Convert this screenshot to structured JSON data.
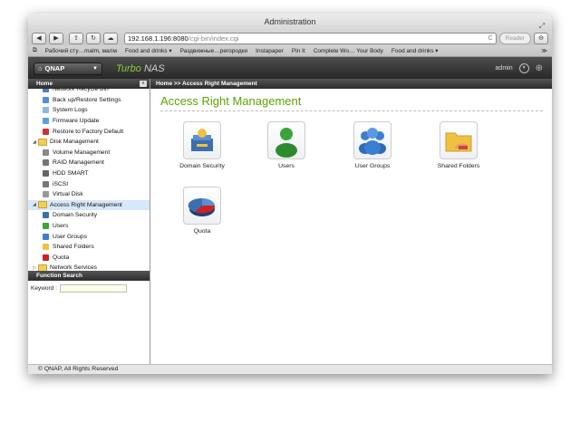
{
  "browser": {
    "window_title": "Administration",
    "url_host": "192.168.1.196:8080",
    "url_path": "/cgi-bin/index.cgi",
    "reader_label": "Reader",
    "bookmarks": [
      "Рабочий сту…malm, малм",
      "Food and drinks ▾",
      "Раздвижные…регородки",
      "Instapaper",
      "Pin It",
      "Complete Wo… Your Body",
      "Food and drinks ▾",
      "≫"
    ]
  },
  "app": {
    "logo_label": "QNAP",
    "product_turbo": "Turbo",
    "product_nas": "NAS",
    "user": "admin"
  },
  "sidebar": {
    "header": "Home",
    "tree": [
      {
        "label": "Network Recycle Bin",
        "level": 2,
        "color": "#4a7fc0"
      },
      {
        "label": "Back up/Restore Settings",
        "level": 2,
        "color": "#4e8fd6"
      },
      {
        "label": "System Logs",
        "level": 2,
        "color": "#8fb6e0"
      },
      {
        "label": "Firmware Update",
        "level": 2,
        "color": "#5aa0dd"
      },
      {
        "label": "Restore to Factory Default",
        "level": 2,
        "color": "#cc3333"
      },
      {
        "label": "Disk Management",
        "level": 1,
        "color": "#f3cf5a"
      },
      {
        "label": "Volume Management",
        "level": 2,
        "color": "#888888"
      },
      {
        "label": "RAID Management",
        "level": 2,
        "color": "#777777"
      },
      {
        "label": "HDD SMART",
        "level": 2,
        "color": "#666666"
      },
      {
        "label": "iSCSI",
        "level": 2,
        "color": "#777777"
      },
      {
        "label": "Virtual Disk",
        "level": 2,
        "color": "#999999"
      },
      {
        "label": "Access Right Management",
        "level": 1,
        "color": "#f3cf5a"
      },
      {
        "label": "Domain Security",
        "level": 2,
        "color": "#3d6fb0"
      },
      {
        "label": "Users",
        "level": 2,
        "color": "#3aa33a"
      },
      {
        "label": "User Groups",
        "level": 2,
        "color": "#3a7fd0"
      },
      {
        "label": "Shared Folders",
        "level": 2,
        "color": "#f0c040"
      },
      {
        "label": "Quota",
        "level": 2,
        "color": "#cc2222"
      },
      {
        "label": "Network Services",
        "level": 1,
        "color": "#f3cf5a"
      }
    ],
    "function_search_header": "Function Search",
    "keyword_label": "Keyword :"
  },
  "main": {
    "breadcrumb": "Home >> Access Right Management",
    "title": "Access Right Management",
    "items": [
      "Domain Security",
      "Users",
      "User Groups",
      "Shared Folders",
      "Quota"
    ]
  },
  "footer": "© QNAP, All Rights Reserved"
}
